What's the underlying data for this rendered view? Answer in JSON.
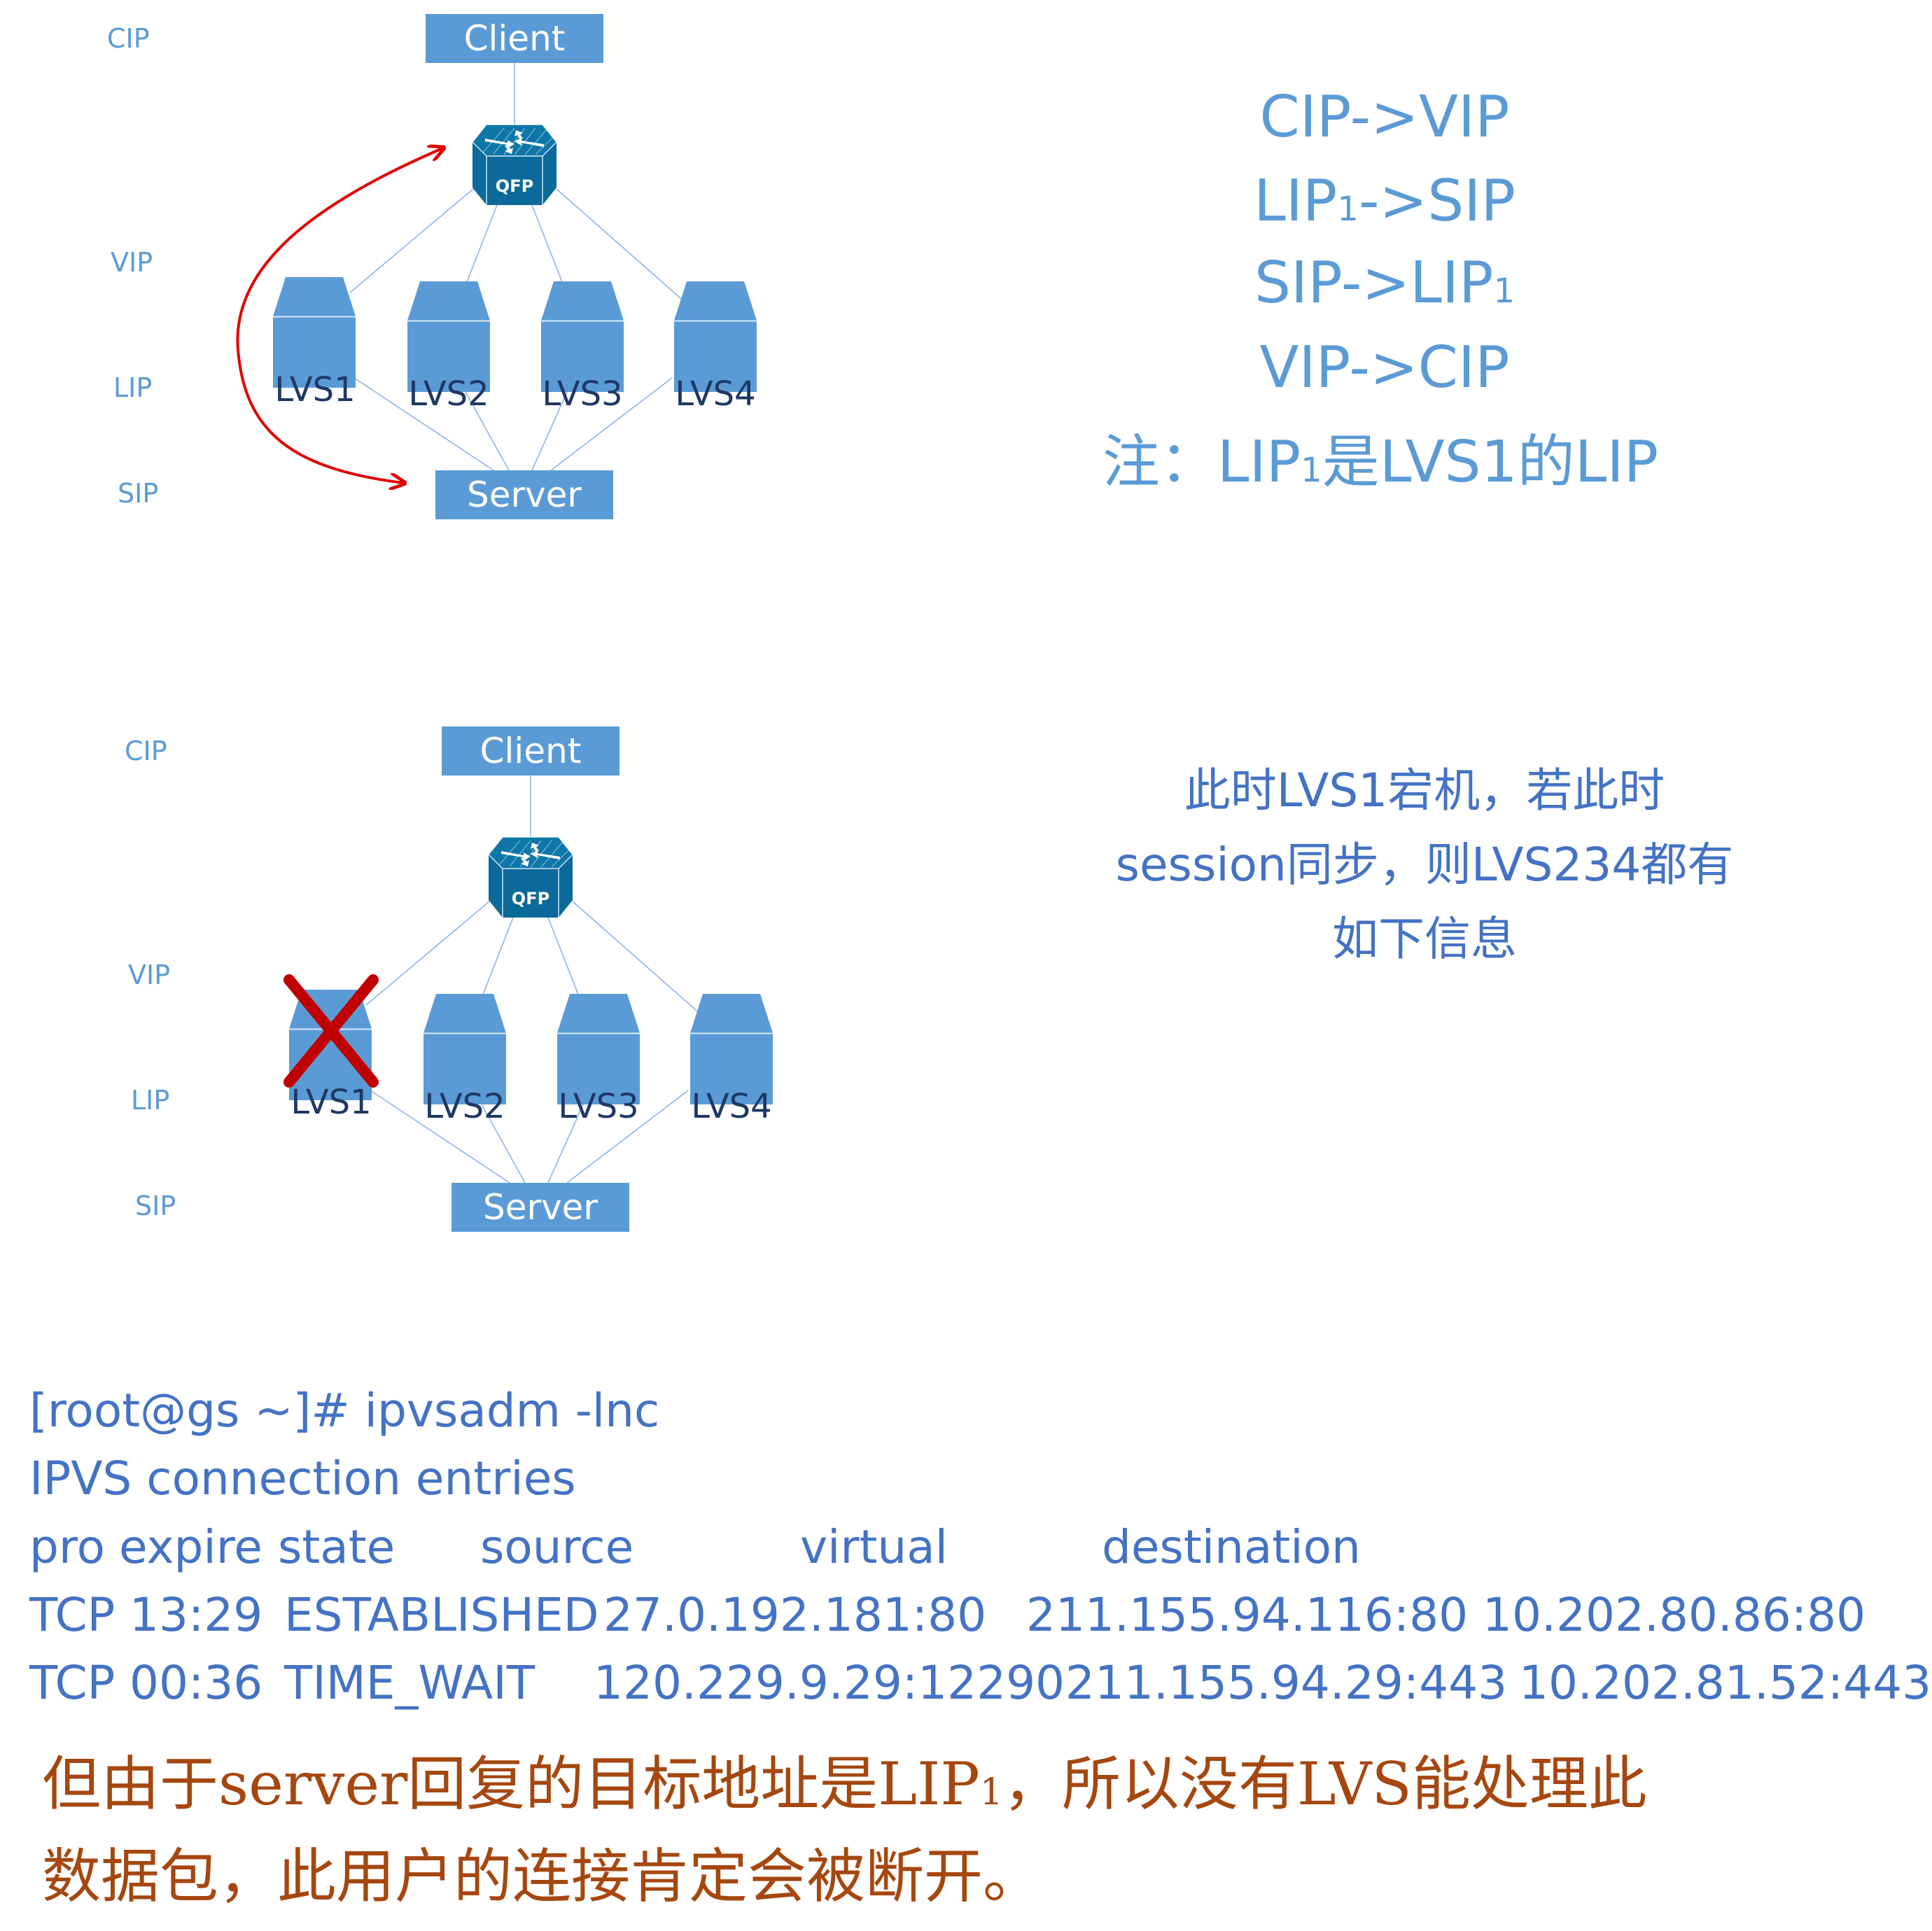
{
  "colors": {
    "node_fill": "#5b9bd5",
    "router_fill": "#0b6a99",
    "label_blue": "#5b9bd5",
    "text_blue": "#4472c4",
    "lvs_label": "#1f3864",
    "arrow_red": "#e00000",
    "cross_red": "#c00000",
    "conclusion": "#a5470f"
  },
  "layer_labels": [
    "CIP",
    "VIP",
    "LIP",
    "SIP"
  ],
  "diagram_top": {
    "client": "Client",
    "router": "QFP",
    "server": "Server",
    "lvs": [
      "LVS1",
      "LVS2",
      "LVS3",
      "LVS4"
    ]
  },
  "diagram_bottom": {
    "client": "Client",
    "router": "QFP",
    "server": "Server",
    "lvs": [
      "LVS1",
      "LVS2",
      "LVS3",
      "LVS4"
    ],
    "failed_node": "LVS1"
  },
  "flow": {
    "lines": [
      {
        "pre": "CIP->VIP",
        "sub": "",
        "post": ""
      },
      {
        "pre": "LIP",
        "sub": "1",
        "post": "->SIP"
      },
      {
        "pre": "SIP->LIP",
        "sub": "1",
        "post": ""
      },
      {
        "pre": "VIP->CIP",
        "sub": "",
        "post": ""
      }
    ],
    "note": {
      "pre": "注：LIP",
      "sub": "1",
      "post": "是LVS1的LIP"
    }
  },
  "failover_note": [
    "此时LVS1宕机，若此时",
    "session同步，则LVS234都有",
    "如下信息"
  ],
  "terminal": {
    "prompt": "[root@gs ~]# ipvsadm -lnc",
    "title": "IPVS connection entries",
    "header": [
      "pro",
      "expire",
      "state",
      "source",
      "virtual",
      "destination"
    ],
    "rows": [
      [
        "TCP",
        "13:29",
        "ESTABLISHED",
        "27.0.192.181:80",
        "211.155.94.116:80",
        "10.202.80.86:80"
      ],
      [
        "TCP",
        "00:36",
        "TIME_WAIT",
        "120.229.9.29:12290",
        "211.155.94.29:443",
        "10.202.81.52:443"
      ]
    ]
  },
  "conclusion": {
    "line1_pre": "但由于server回复的目标地址是LIP",
    "line1_sub": "1",
    "line1_post": "，所以没有LVS能处理此",
    "line2": "数据包，此用户的连接肯定会被断开。"
  }
}
